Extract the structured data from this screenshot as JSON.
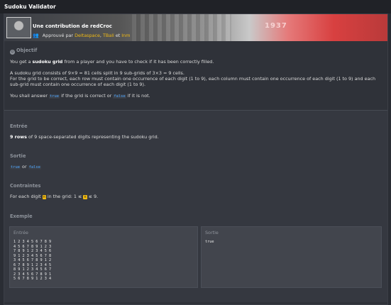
{
  "window": {
    "title": "Sudoku Validator"
  },
  "banner": {
    "contribution": "Une contribution de redCroc",
    "approved_prefix": "Approuvé par",
    "approvers": [
      "Deltaspace",
      "TBali",
      "Inm"
    ],
    "sep": ",",
    "and": "et",
    "year_text": "1937"
  },
  "objective": {
    "heading": "Objectif",
    "p1_pre": "You get a",
    "p1_bold": "sudoku grid",
    "p1_post": "from a player and you have to check if it has been correctly filled.",
    "p2_l1": "A sudoku grid consists of 9×9 = 81 cells split in 9 sub-grids of 3×3 = 9 cells.",
    "p2_l2": "For the grid to be correct, each row must contain one occurrence of each digit (1 to 9), each column must contain one occurrence of each digit (1 to 9) and each",
    "p2_l3": "sub-grid must contain one occurrence of each digit (1 to 9).",
    "p3_pre": "You shall answer",
    "p3_true": "true",
    "p3_mid": "if the grid is correct or",
    "p3_false": "false",
    "p3_post": "if it is not."
  },
  "input": {
    "heading": "Entrée",
    "bold": "9 rows",
    "text": "of 9 space-separated digits representing the sudoku grid."
  },
  "output": {
    "heading": "Sortie",
    "true": "true",
    "or": "or",
    "false": "false"
  },
  "constraints": {
    "heading": "Contraintes",
    "pre": "For each digit",
    "var": "n",
    "mid": "in the grid: 1 ≤",
    "var2": "n",
    "post": "≤ 9."
  },
  "example": {
    "heading": "Exemple",
    "input_label": "Entrée",
    "output_label": "Sortie",
    "input_lines": [
      "1 2 3 4 5 6 7 8 9",
      "4 5 6 7 8 9 1 2 3",
      "7 8 9 1 2 3 4 5 6",
      "9 1 2 3 4 5 6 7 8",
      "3 4 5 6 7 8 9 1 2",
      "6 7 8 9 1 2 3 4 5",
      "8 9 1 2 3 4 5 6 7",
      "2 3 4 5 6 7 8 9 1",
      "5 6 7 8 9 1 2 3 4"
    ],
    "output_value": "true"
  }
}
